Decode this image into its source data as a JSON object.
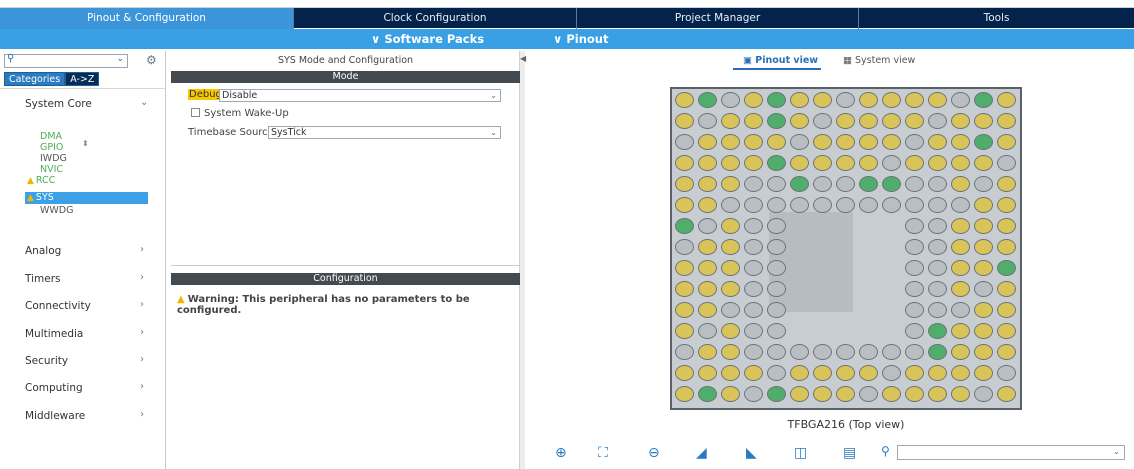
{
  "top_tabs": [
    {
      "label": "Pinout & Configuration",
      "active": true
    },
    {
      "label": "Clock Configuration",
      "active": false
    },
    {
      "label": "Project Manager",
      "active": false
    },
    {
      "label": "Tools",
      "active": false
    }
  ],
  "sub_bar": {
    "software_packs": "∨ Software Packs",
    "pinout": "∨ Pinout"
  },
  "left": {
    "category_tabs": [
      "Categories",
      "A->Z"
    ],
    "system_core": "System Core",
    "peripherals": [
      "DMA",
      "GPIO",
      "IWDG",
      "NVIC",
      "RCC",
      "SYS",
      "WWDG"
    ],
    "categories": [
      "Analog",
      "Timers",
      "Connectivity",
      "Multimedia",
      "Security",
      "Computing",
      "Middleware"
    ]
  },
  "mid": {
    "title": "SYS Mode and Configuration",
    "mode_header": "Mode",
    "debug_label": "Debug",
    "debug_value": "Disable",
    "wakeup_label": "System Wake-Up",
    "timebase_label": "Timebase Source",
    "timebase_value": "SysTick",
    "config_header": "Configuration",
    "warning": "Warning: This peripheral has no parameters to be configured."
  },
  "right": {
    "pinout_view": "Pinout view",
    "system_view": "System view",
    "package_label": "TFBGA216 (Top view)"
  },
  "colors": {
    "nav_dark": "#03234b",
    "nav_active": "#3c95d8",
    "sub_bar": "#39a0e6",
    "pin_gpio": "#d9c45a",
    "pin_power": "#b9bec3",
    "pin_used": "#4fae6c",
    "warning": "#f2b400"
  }
}
